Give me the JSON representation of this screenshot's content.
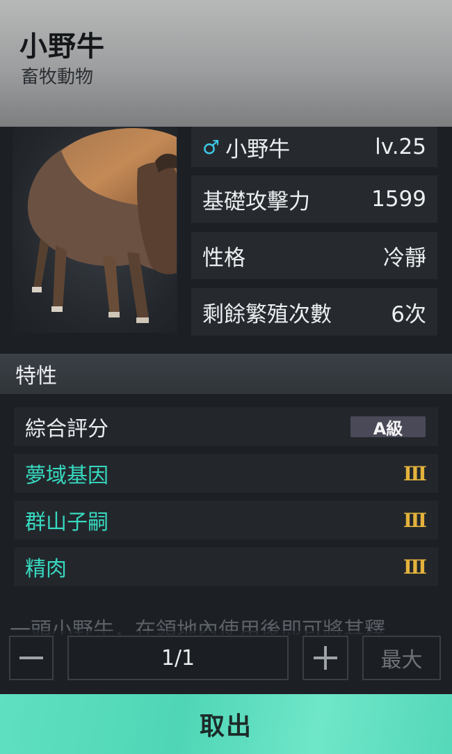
{
  "header": {
    "title": "小野牛",
    "subtitle": "畜牧動物"
  },
  "stats": [
    {
      "label": "小野牛",
      "value": "lv.25",
      "gender_icon": "male-icon",
      "gender_symbol": "♂"
    },
    {
      "label": "基礎攻擊力",
      "value": "1599"
    },
    {
      "label": "性格",
      "value": "冷靜"
    },
    {
      "label": "剩餘繁殖次數",
      "value": "6次"
    }
  ],
  "traits_section": {
    "title": "特性"
  },
  "traits": {
    "overall": {
      "label": "綜合評分",
      "grade": "A級"
    },
    "items": [
      {
        "name": "夢域基因",
        "level": "Ⅲ"
      },
      {
        "name": "群山子嗣",
        "level": "Ⅲ"
      },
      {
        "name": "精肉",
        "level": "Ⅲ"
      }
    ]
  },
  "description": "一頭小野牛，在領地內使用後即可將其釋",
  "quantity": {
    "value": "1/1",
    "max_label": "最大"
  },
  "action": {
    "take_label": "取出"
  },
  "colors": {
    "accent_cyan": "#37d9c0",
    "gender_cyan": "#3ec9e6",
    "roman_gold": "#e3b23c",
    "button_mint": "#5fe0c0"
  }
}
